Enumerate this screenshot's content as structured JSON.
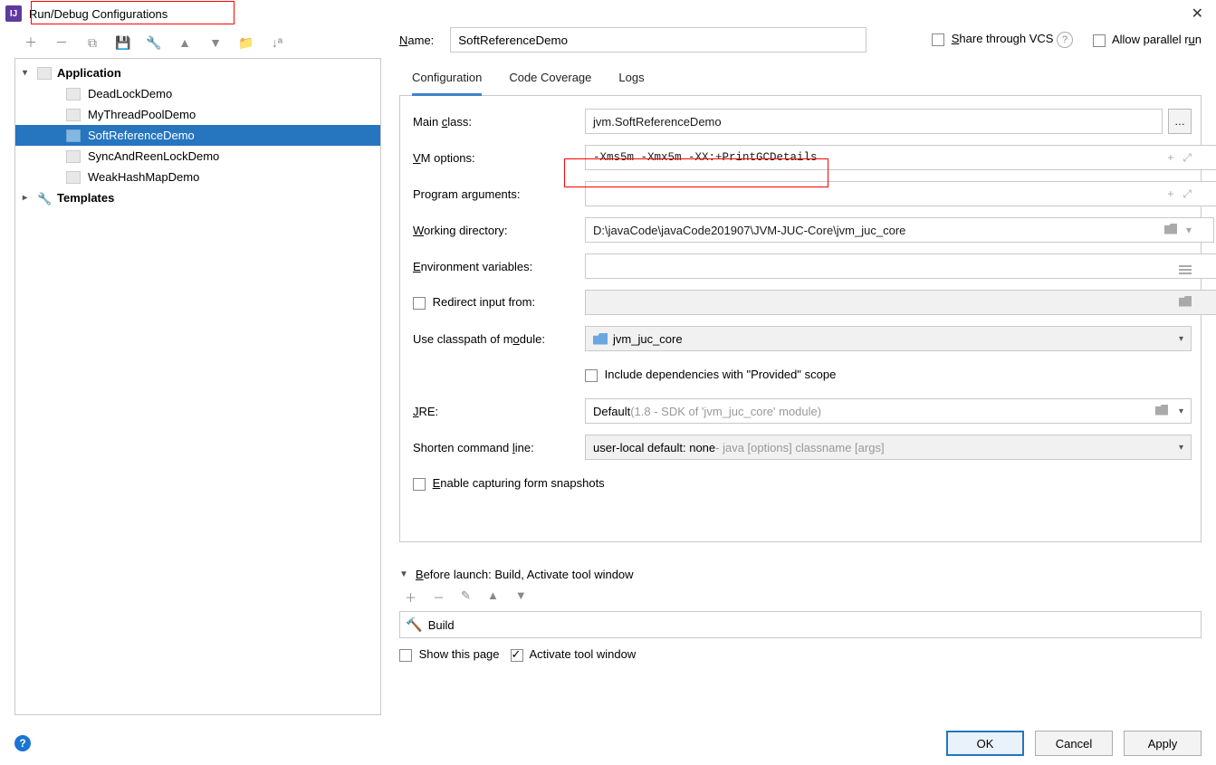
{
  "window": {
    "title": "Run/Debug Configurations"
  },
  "tree": {
    "root_application": "Application",
    "items": [
      "DeadLockDemo",
      "MyThreadPoolDemo",
      "SoftReferenceDemo",
      "SyncAndReenLockDemo",
      "WeakHashMapDemo"
    ],
    "selected_index": 2,
    "templates": "Templates"
  },
  "header": {
    "name_label": "Name:",
    "name_value": "SoftReferenceDemo",
    "share_label": "Share through VCS",
    "allow_label": "Allow parallel run"
  },
  "tabs": {
    "configuration": "Configuration",
    "code_coverage": "Code Coverage",
    "logs": "Logs"
  },
  "form": {
    "main_class_label": "Main class:",
    "main_class_value": "jvm.SoftReferenceDemo",
    "vm_label": "VM options:",
    "vm_value": "-Xms5m -Xmx5m -XX:+PrintGCDetails",
    "prog_label": "Program arguments:",
    "prog_value": "",
    "workdir_label": "Working directory:",
    "workdir_value": "D:\\javaCode\\javaCode201907\\JVM-JUC-Core\\jvm_juc_core",
    "env_label": "Environment variables:",
    "env_value": "",
    "redirect_label": "Redirect input from:",
    "classpath_label": "Use classpath of module:",
    "classpath_value": "jvm_juc_core",
    "include_label": "Include dependencies with \"Provided\" scope",
    "jre_label": "JRE:",
    "jre_value": "Default ",
    "jre_hint": "(1.8 - SDK of 'jvm_juc_core' module)",
    "shorten_label": "Shorten command line:",
    "shorten_value": "user-local default: none ",
    "shorten_hint": "- java [options] classname [args]",
    "enable_snap_label": "Enable capturing form snapshots"
  },
  "before": {
    "title": "Before launch: Build, Activate tool window",
    "build_item": "Build",
    "show_label": "Show this page",
    "activate_label": "Activate tool window"
  },
  "footer": {
    "ok": "OK",
    "cancel": "Cancel",
    "apply": "Apply"
  }
}
